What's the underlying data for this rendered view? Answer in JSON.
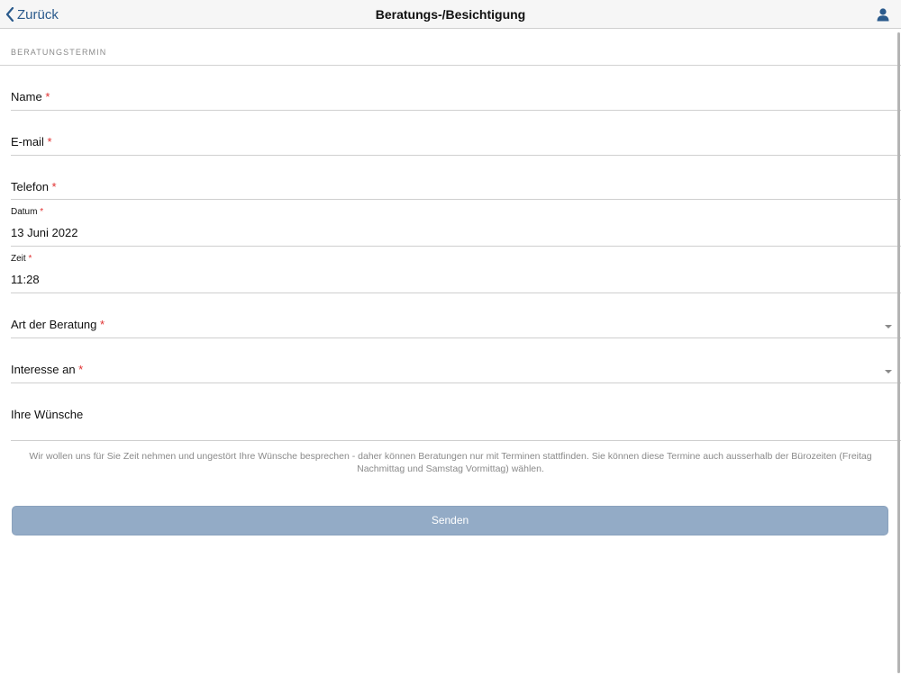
{
  "navbar": {
    "back_label": "Zurück",
    "title": "Beratungs-/Besichtigung"
  },
  "section": {
    "header": "BERATUNGSTERMIN"
  },
  "form": {
    "required_mark": "*",
    "name_label": "Name",
    "email_label": "E-mail",
    "phone_label": "Telefon",
    "date_label": "Datum",
    "date_value": "13 Juni 2022",
    "time_label": "Zeit",
    "time_value": "11:28",
    "consultation_type_label": "Art der Beratung",
    "interest_label": "Interesse an",
    "wishes_label": "Ihre Wünsche"
  },
  "info_text": "Wir wollen uns für Sie Zeit nehmen und ungestört Ihre Wünsche besprechen - daher können Beratungen nur mit Terminen stattfinden. Sie können diese Termine auch ausserhalb der Bürozeiten (Freitag Nachmittag und Samstag Vormittag) wählen.",
  "submit_label": "Senden",
  "icons": {
    "back": "chevron-left-icon",
    "user": "user-icon",
    "dropdown": "chevron-down-icon"
  },
  "colors": {
    "accent": "#2a5a8c",
    "required": "#e03030",
    "button": "#93abc6",
    "muted_text": "#8a8a8a"
  }
}
